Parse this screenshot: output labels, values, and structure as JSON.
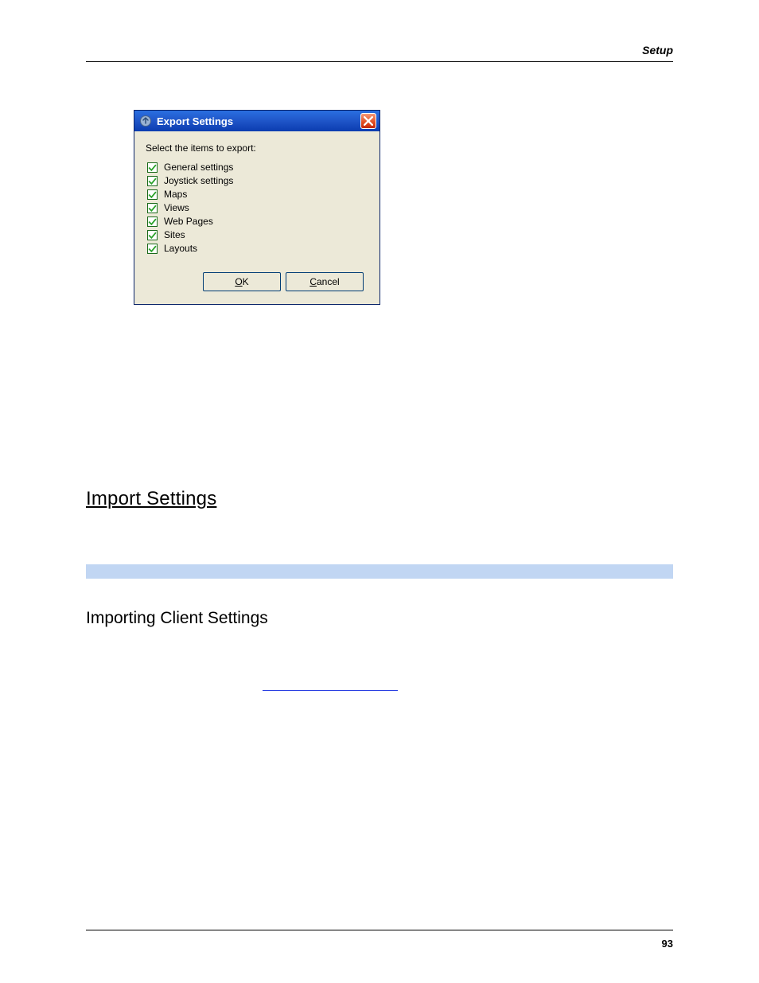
{
  "header": {
    "section": "Setup"
  },
  "footer": {
    "page": "93"
  },
  "dialog": {
    "title": "Export Settings",
    "prompt": "Select the items to export:",
    "items": [
      {
        "label": "General settings",
        "checked": true
      },
      {
        "label": "Joystick settings",
        "checked": true
      },
      {
        "label": "Maps",
        "checked": true
      },
      {
        "label": "Views",
        "checked": true
      },
      {
        "label": "Web Pages",
        "checked": true
      },
      {
        "label": "Sites",
        "checked": true
      },
      {
        "label": "Layouts",
        "checked": true
      }
    ],
    "buttons": {
      "ok_pre": "O",
      "ok_key": "",
      "ok_label": "K",
      "cancel_pre": "",
      "cancel_key": "C",
      "cancel_label": "ancel"
    },
    "ok_underline": "O",
    "ok_rest": "K",
    "cancel_underline": "C",
    "cancel_rest": "ancel"
  },
  "sections": {
    "import": "Import Settings",
    "sub": "Importing Client Settings"
  }
}
